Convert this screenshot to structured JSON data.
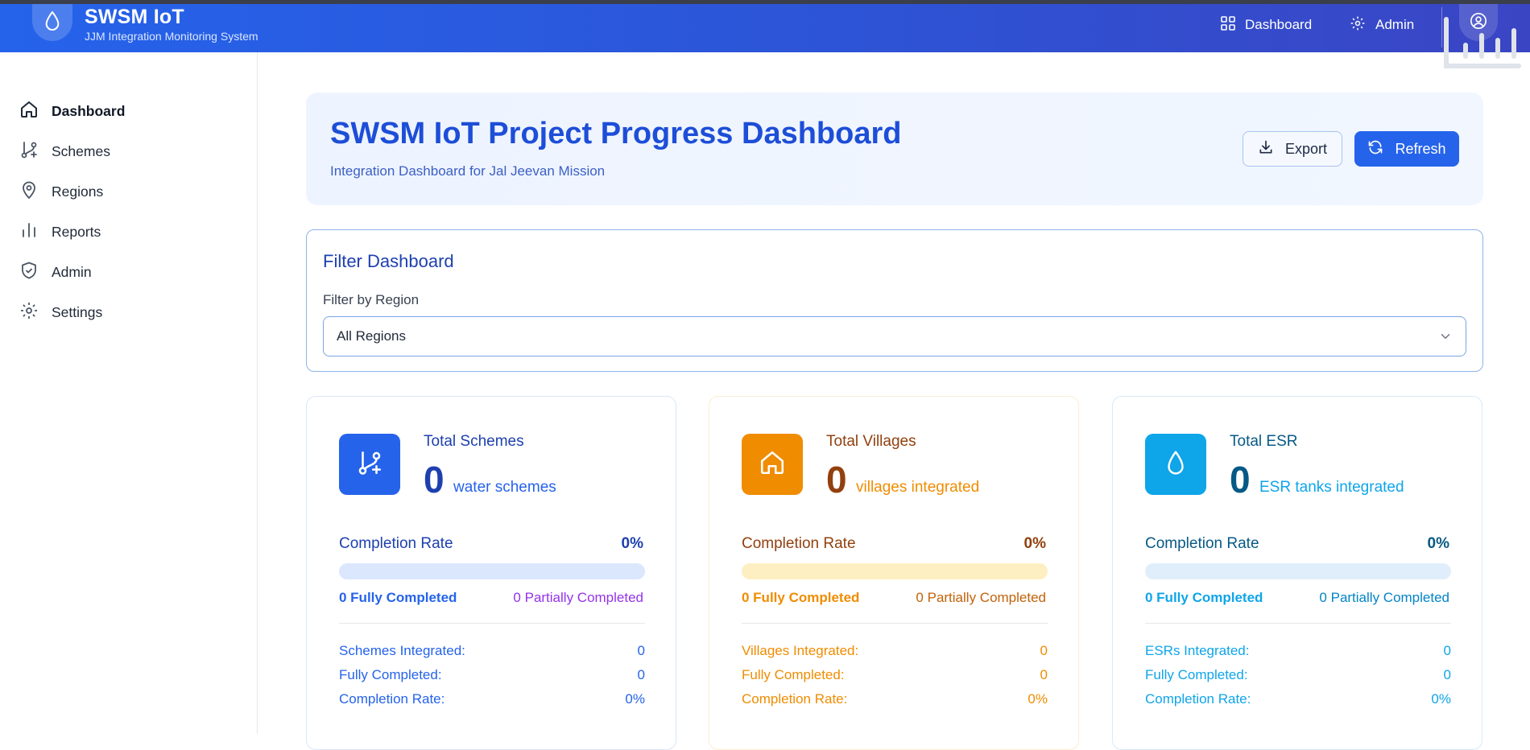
{
  "header": {
    "app_title": "SWSM IoT",
    "app_subtitle": "JJM Integration Monitoring System",
    "nav": [
      {
        "label": "Dashboard",
        "icon": "grid-icon"
      },
      {
        "label": "Admin",
        "icon": "gear-icon"
      }
    ],
    "avatar_icon": "user-circle-icon"
  },
  "sidebar": {
    "items": [
      {
        "label": "Dashboard",
        "icon": "home-icon",
        "active": true
      },
      {
        "label": "Schemes",
        "icon": "git-branch-plus-icon"
      },
      {
        "label": "Regions",
        "icon": "map-pin-icon"
      },
      {
        "label": "Reports",
        "icon": "bar-chart-icon"
      },
      {
        "label": "Admin",
        "icon": "shield-check-icon"
      },
      {
        "label": "Settings",
        "icon": "gear-icon"
      }
    ]
  },
  "hero": {
    "title": "SWSM IoT Project Progress Dashboard",
    "subtitle": "Integration Dashboard for Jal Jeevan Mission",
    "export_label": "Export",
    "refresh_label": "Refresh"
  },
  "filter": {
    "title": "Filter Dashboard",
    "label": "Filter by Region",
    "selected": "All Regions"
  },
  "cards": [
    {
      "label": "Total Schemes",
      "value": "0",
      "unit": "water schemes",
      "icon": "git-branch-plus-icon",
      "completion_label": "Completion Rate",
      "completion_value": "0%",
      "completion_fraction": 0,
      "fully_completed": "0 Fully Completed",
      "partially_completed": "0 Partially Completed",
      "rows": [
        {
          "label": "Schemes Integrated:",
          "value": "0"
        },
        {
          "label": "Fully Completed:",
          "value": "0"
        },
        {
          "label": "Completion Rate:",
          "value": "0%"
        }
      ],
      "colors": {
        "accent": "#1e40af",
        "icon_bg": "#2563eb",
        "bar_track": "#dbe7fd",
        "partial": "#9333ea",
        "border": "#dbe6f7"
      }
    },
    {
      "label": "Total Villages",
      "value": "0",
      "unit": "villages integrated",
      "icon": "house-icon",
      "completion_label": "Completion Rate",
      "completion_value": "0%",
      "completion_fraction": 0,
      "fully_completed": "0 Fully Completed",
      "partially_completed": "0 Partially Completed",
      "rows": [
        {
          "label": "Villages Integrated:",
          "value": "0"
        },
        {
          "label": "Fully Completed:",
          "value": "0"
        },
        {
          "label": "Completion Rate:",
          "value": "0%"
        }
      ],
      "colors": {
        "accent": "#92400e",
        "icon_bg": "#f08c00",
        "bar_track": "#fdefc2",
        "partial": "#c2620a",
        "border": "#fbedd0"
      }
    },
    {
      "label": "Total ESR",
      "value": "0",
      "unit": "ESR tanks integrated",
      "icon": "droplet-icon",
      "completion_label": "Completion Rate",
      "completion_value": "0%",
      "completion_fraction": 0,
      "fully_completed": "0 Fully Completed",
      "partially_completed": "0 Partially Completed",
      "rows": [
        {
          "label": "ESRs Integrated:",
          "value": "0"
        },
        {
          "label": "Fully Completed:",
          "value": "0"
        },
        {
          "label": "Completion Rate:",
          "value": "0%"
        }
      ],
      "colors": {
        "accent": "#075985",
        "icon_bg": "#0ea5e9",
        "bar_track": "#dfeefa",
        "partial": "#0284c7",
        "border": "#d7eaf7"
      }
    }
  ]
}
